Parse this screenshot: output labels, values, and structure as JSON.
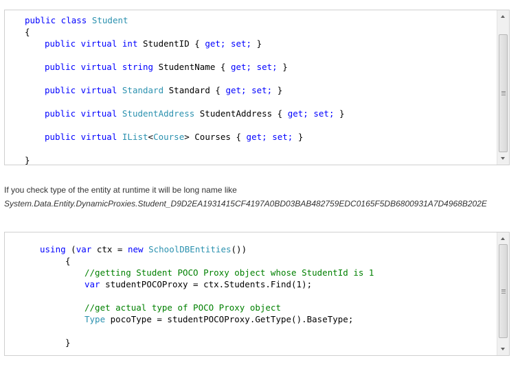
{
  "snippet1": {
    "line1": {
      "kw": "public class",
      "type": "Student"
    },
    "line2": "{",
    "line3": {
      "kw1": "public virtual",
      "kw2": "int",
      "rest": "StudentID {",
      "get": "get;",
      "set": "set;",
      "close": "}"
    },
    "line4": {
      "kw1": "public virtual",
      "kw2": "string",
      "rest": "StudentName {",
      "get": "get;",
      "set": "set;",
      "close": "}"
    },
    "line5": {
      "kw1": "public virtual",
      "type": "Standard",
      "rest": "Standard {",
      "get": "get;",
      "set": "set;",
      "close": "}"
    },
    "line6": {
      "kw1": "public virtual",
      "type": "StudentAddress",
      "rest": "StudentAddress {",
      "get": "get;",
      "set": "set;",
      "close": "}"
    },
    "line7": {
      "kw1": "public virtual",
      "type1": "IList",
      "lt": "<",
      "type2": "Course",
      "gt": ">",
      "rest": "Courses {",
      "get": "get;",
      "set": "set;",
      "close": "}"
    },
    "line8": "}"
  },
  "prose": {
    "text1": "If you check type of the entity at runtime it will be long name like",
    "text2": "System.Data.Entity.DynamicProxies.Student_D9D2EA1931415CF4197A0BD03BAB482759EDC0165F5DB6800931A7D4968B202E"
  },
  "snippet2": {
    "line1": {
      "kw": "using",
      "p1": "(",
      "kw2": "var",
      "mid": "ctx =",
      "kw3": "new",
      "type": "SchoolDBEntities",
      "end": "())"
    },
    "line2": "{",
    "line3": "//getting Student POCO Proxy object whose StudentId is 1",
    "line4": {
      "kw": "var",
      "rest": "studentPOCOProxy = ctx.Students.Find(1);"
    },
    "line5": "//get actual type of POCO Proxy object",
    "line6": {
      "type": "Type",
      "rest": "pocoType = studentPOCOProxy.GetType().BaseType;"
    },
    "line7": "}"
  },
  "colors": {
    "keyword": "#0000ff",
    "type": "#2b91af",
    "comment": "#008000"
  }
}
